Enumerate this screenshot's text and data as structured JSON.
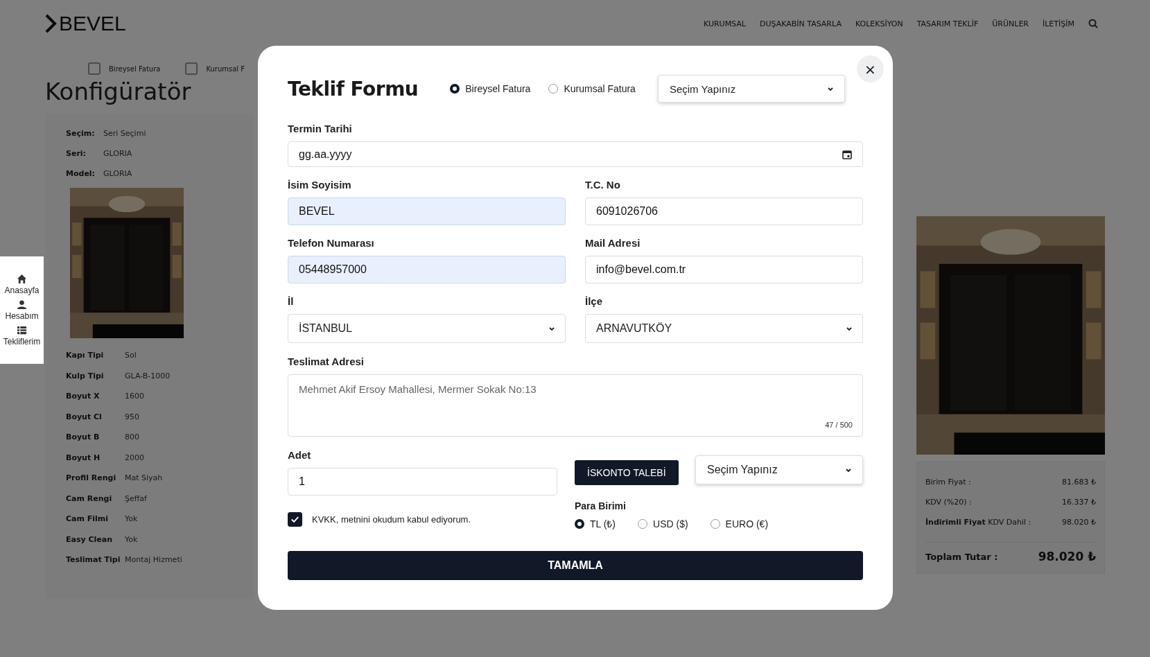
{
  "background_page": {
    "logo": "BEVEL",
    "nav": [
      "KURUMSAL",
      "DUŞAKABİN TASARLA",
      "KOLEKSİYON",
      "TASARIM TEKLİF",
      "ÜRÜNLER",
      "İLETİŞİM"
    ],
    "steps": [
      "Bireysel Fatura",
      "Kurumsal F"
    ],
    "page_title": "Konfigüratör",
    "summary": [
      {
        "label": "Seçim:",
        "value": "Seri Seçimi"
      },
      {
        "label": "Seri:",
        "value": "GLORIA"
      },
      {
        "label": "Model:",
        "value": "GLORIA"
      }
    ],
    "specs": [
      {
        "label": "Kapı Tipi",
        "value": "Sol"
      },
      {
        "label": "Kulp Tipi",
        "value": "GLA-B-1000"
      },
      {
        "label": "Boyut X",
        "value": "1600"
      },
      {
        "label": "Boyut Cl",
        "value": "950"
      },
      {
        "label": "Boyut B",
        "value": "800"
      },
      {
        "label": "Boyut H",
        "value": "2000"
      },
      {
        "label": "Profil Rengi",
        "value": "Mat Siyah"
      },
      {
        "label": "Cam Rengi",
        "value": "Şeffaf"
      },
      {
        "label": "Cam Filmi",
        "value": "Yok"
      },
      {
        "label": "Easy Clean",
        "value": "Yok"
      },
      {
        "label": "Teslimat Tipi",
        "value": "Montaj Hizmeti"
      }
    ],
    "prices": [
      {
        "label": "Birim Fiyat :",
        "value": "81.683 ₺"
      },
      {
        "label": "KDV (%20) :",
        "value": "16.337 ₺"
      },
      {
        "label": "**İndirimli Fiyat** KDV Dahil :",
        "value": "98.020 ₺"
      }
    ],
    "total": {
      "label": "Toplam Tutar :",
      "value": "98.020 ₺"
    }
  },
  "side_menu": [
    {
      "kind": "home",
      "label": "Anasayfa"
    },
    {
      "kind": "user",
      "label": "Hesabım"
    },
    {
      "kind": "list",
      "label": "Tekliflerim"
    }
  ],
  "modal": {
    "title": "Teklif Formu",
    "close": "×",
    "invoice_types": [
      {
        "label": "Bireysel Fatura",
        "selected": true
      },
      {
        "label": "Kurumsal Fatura",
        "selected": false
      }
    ],
    "invoice_select": {
      "value": "Seçim Yapınız"
    },
    "rows": [
      [
        {
          "kind": "date",
          "label": "Termin Tarihi",
          "placeholder": "gg.aa.yyyy"
        }
      ],
      [
        {
          "kind": "text",
          "label": "İsim Soyisim",
          "value": "BEVEL",
          "autofilled": true
        },
        {
          "kind": "text",
          "label": "T.C. No",
          "value": "6091026706",
          "autofilled": false
        }
      ],
      [
        {
          "kind": "text",
          "label": "Telefon Numarası",
          "value": "05448957000",
          "autofilled": true
        },
        {
          "kind": "text",
          "label": "Mail Adresi",
          "value": "info@bevel.com.tr",
          "autofilled": false
        }
      ],
      [
        {
          "kind": "select",
          "label": "İl",
          "value": "İSTANBUL"
        },
        {
          "kind": "select",
          "label": "İlçe",
          "value": "ARNAVUTKÖY"
        }
      ]
    ],
    "address": {
      "label": "Teslimat Adresi",
      "value": "Mehmet Akif Ersoy Mahallesi, Mermer Sokak No:13",
      "counter": "47 / 500"
    },
    "quantity": {
      "label": "Adet",
      "value": "1"
    },
    "discount_button": "İSKONTO TALEBİ",
    "discount_select": {
      "value": "Seçim Yapınız"
    },
    "consent": {
      "label": "KVKK, metnini okudum kabul ediyorum.",
      "checked": true
    },
    "currency": {
      "label": "Para Birimi",
      "options": [
        {
          "label": "TL (₺)",
          "selected": true
        },
        {
          "label": "USD ($)",
          "selected": false
        },
        {
          "label": "EURO (€)",
          "selected": false
        }
      ]
    },
    "submit": "TAMAMLA"
  }
}
